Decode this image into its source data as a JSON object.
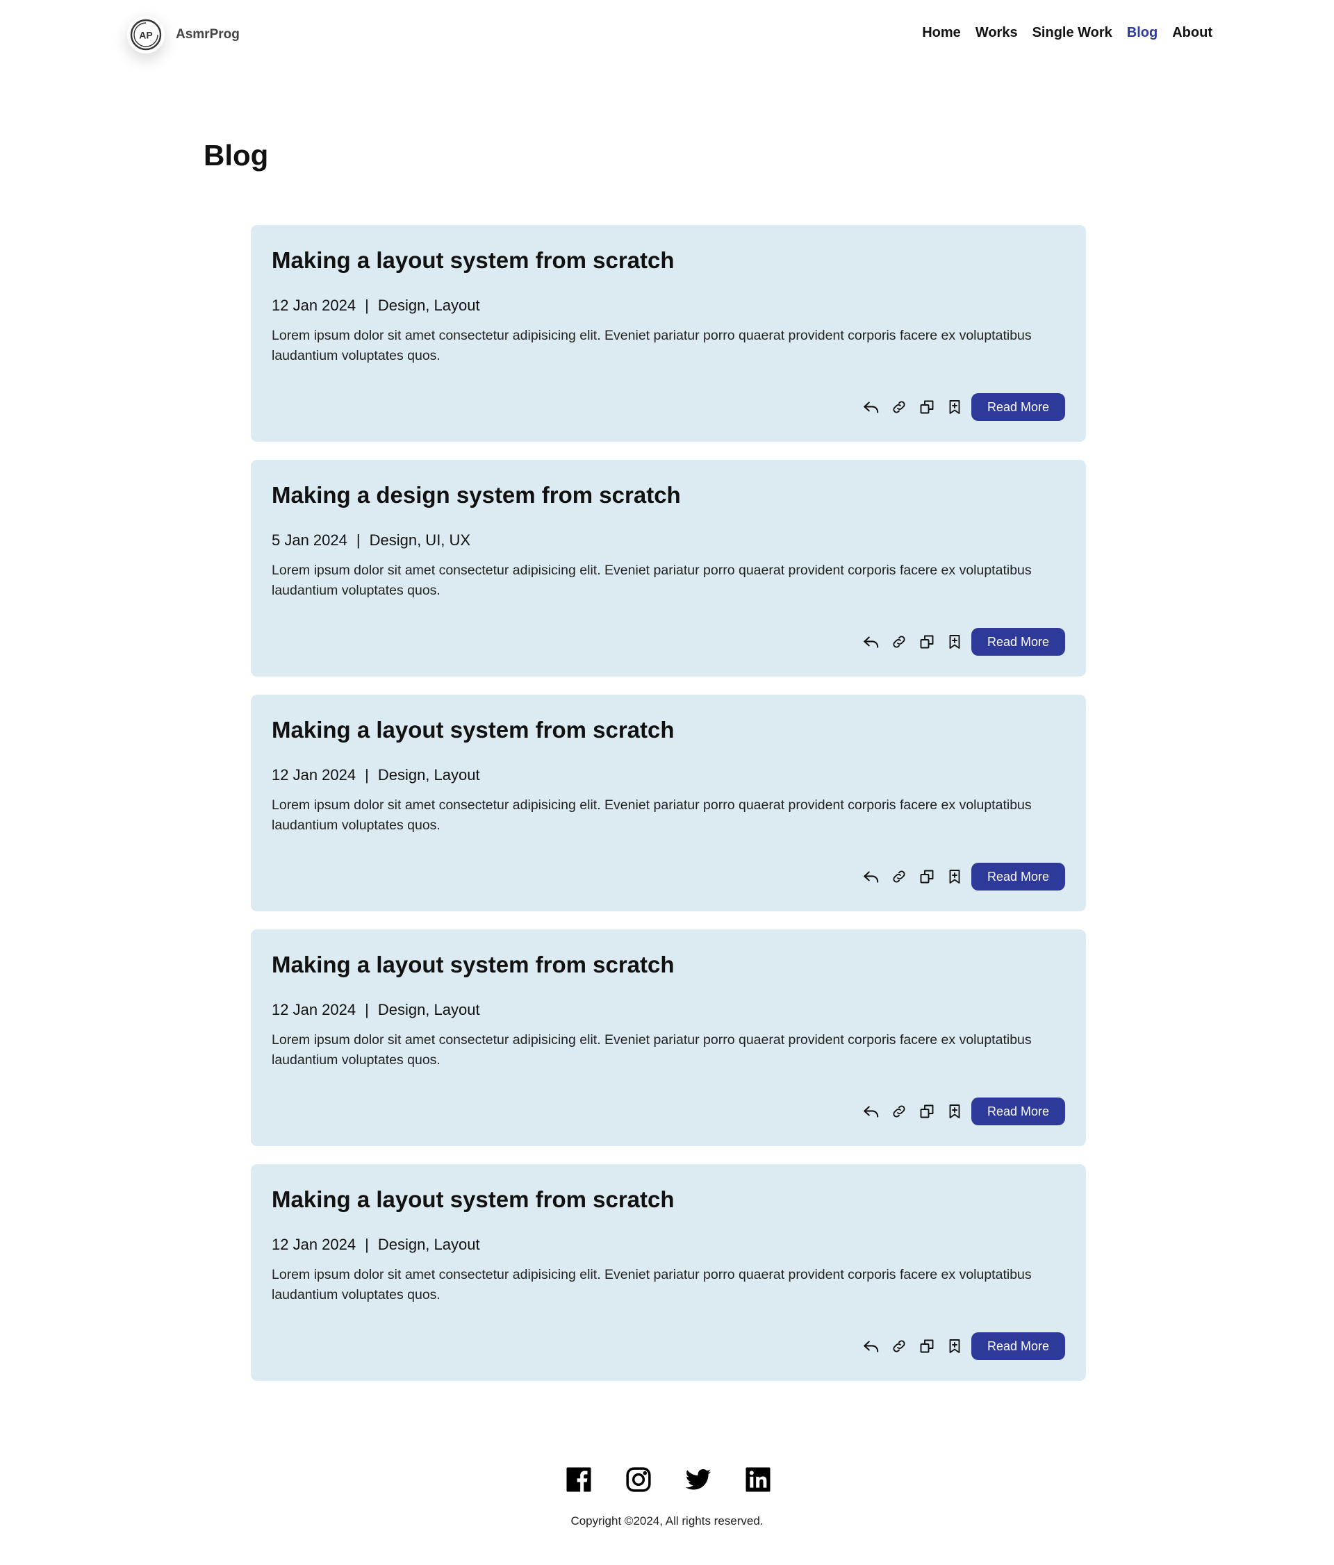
{
  "brand": {
    "logo_text": "AP",
    "name": "AsmrProg"
  },
  "nav": {
    "items": [
      {
        "label": "Home",
        "active": false
      },
      {
        "label": "Works",
        "active": false
      },
      {
        "label": "Single Work",
        "active": false
      },
      {
        "label": "Blog",
        "active": true
      },
      {
        "label": "About",
        "active": false
      }
    ]
  },
  "page": {
    "title": "Blog"
  },
  "posts": [
    {
      "title": "Making a layout system from scratch",
      "date": "12 Jan 2024",
      "separator": "|",
      "tags": "Design, Layout",
      "excerpt": "Lorem ipsum dolor sit amet consectetur adipisicing elit. Eveniet pariatur porro quaerat provident corporis facere ex voluptatibus laudantium voluptates quos.",
      "button_label": "Read More"
    },
    {
      "title": "Making a design system from scratch",
      "date": "5 Jan 2024",
      "separator": "|",
      "tags": "Design, UI, UX",
      "excerpt": "Lorem ipsum dolor sit amet consectetur adipisicing elit. Eveniet pariatur porro quaerat provident corporis facere ex voluptatibus laudantium voluptates quos.",
      "button_label": "Read More"
    },
    {
      "title": "Making a layout system from scratch",
      "date": "12 Jan 2024",
      "separator": "|",
      "tags": "Design, Layout",
      "excerpt": "Lorem ipsum dolor sit amet consectetur adipisicing elit. Eveniet pariatur porro quaerat provident corporis facere ex voluptatibus laudantium voluptates quos.",
      "button_label": "Read More"
    },
    {
      "title": "Making a layout system from scratch",
      "date": "12 Jan 2024",
      "separator": "|",
      "tags": "Design, Layout",
      "excerpt": "Lorem ipsum dolor sit amet consectetur adipisicing elit. Eveniet pariatur porro quaerat provident corporis facere ex voluptatibus laudantium voluptates quos.",
      "button_label": "Read More"
    },
    {
      "title": "Making a layout system from scratch",
      "date": "12 Jan 2024",
      "separator": "|",
      "tags": "Design, Layout",
      "excerpt": "Lorem ipsum dolor sit amet consectetur adipisicing elit. Eveniet pariatur porro quaerat provident corporis facere ex voluptatibus laudantium voluptates quos.",
      "button_label": "Read More"
    }
  ],
  "post_action_icons": [
    "reply-icon",
    "link-icon",
    "copy-icon",
    "bookmark-add-icon"
  ],
  "footer": {
    "socials": [
      "facebook-icon",
      "instagram-icon",
      "twitter-icon",
      "linkedin-icon"
    ],
    "copyright": "Copyright ©2024, All rights reserved."
  },
  "colors": {
    "accent": "#2e3a9a",
    "card_background": "#dcebf1",
    "text": "#111111"
  }
}
